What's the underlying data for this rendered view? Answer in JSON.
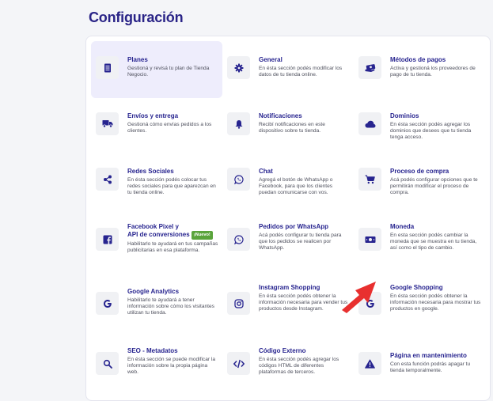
{
  "page": {
    "title": "Configuración"
  },
  "cards": {
    "planes": {
      "title": "Planes",
      "desc": "Gestioná y revisá tu plan de Tienda Negocio.",
      "icon": "document-list-icon"
    },
    "general": {
      "title": "General",
      "desc": "En ésta sección podés modificar los datos de tu tienda online.",
      "icon": "gear-icon"
    },
    "pagos": {
      "title": "Métodos de pagos",
      "desc": "Activa y gestioná los proveedores de pago de tu tienda.",
      "icon": "money-hand-icon"
    },
    "envios": {
      "title": "Envíos y entrega",
      "desc": "Gestioná cómo envías pedidos a los clientes.",
      "icon": "truck-icon"
    },
    "notificaciones": {
      "title": "Notificaciones",
      "desc": "Recibí notificaciones en este dispositivo sobre tu tienda.",
      "icon": "bell-icon"
    },
    "dominios": {
      "title": "Dominios",
      "desc": "En ésta sección podés agregar los dominios que desees que tu tienda tenga acceso.",
      "icon": "cloud-icon"
    },
    "redes": {
      "title": "Redes Sociales",
      "desc": "En ésta sección podés colocar tus redes sociales para que aparezcan en tu tienda online.",
      "icon": "share-icon"
    },
    "chat": {
      "title": "Chat",
      "desc": "Agregá el botón de WhatsApp o Facebook, para que los clientes puedan comunicarse con vos.",
      "icon": "whatsapp-icon"
    },
    "compra": {
      "title": "Proceso de compra",
      "desc": "Acá podés configurar opciones que te permitirán modificar el proceso de compra.",
      "icon": "cart-icon"
    },
    "pixel": {
      "title_line1": "Facebook Pixel y",
      "title_line2": "API de conversiones",
      "badge": "¡Nuevo!",
      "desc": "Habilitarlo te ayudará en tus campañas publicitarias en esa plataforma.",
      "icon": "facebook-icon"
    },
    "pedidos_wa": {
      "title": "Pedidos por WhatsApp",
      "desc": "Acá podés configurar tu tienda para que los pedidos se realicen por WhatsApp.",
      "icon": "whatsapp-icon"
    },
    "moneda": {
      "title": "Moneda",
      "desc": "En esta sección podés cambiar la moneda que se muestra en tu tienda, así como el tipo de cambio.",
      "icon": "banknote-icon"
    },
    "analytics": {
      "title": "Google Analytics",
      "desc": "Habilitarlo te ayudará a tener información sobre cómo los visitantes utilizan tu tienda.",
      "icon": "google-icon"
    },
    "instagram": {
      "title": "Instagram Shopping",
      "desc": "En ésta sección podés obtener la información necesaria para vender tus productos desde Instagram.",
      "icon": "instagram-icon"
    },
    "gshopping": {
      "title": "Google Shopping",
      "desc": "En ésta sección podés obtener la información necesaria para mostrar tus productos en google.",
      "icon": "google-icon"
    },
    "seo": {
      "title": "SEO - Metadatos",
      "desc": "En ésta sección se puede modificar la información sobre la propia página web.",
      "icon": "search-icon"
    },
    "codigo": {
      "title": "Código Externo",
      "desc": "En ésta sección podés agregar los códigos HTML de diferentes plataformas de terceros.",
      "icon": "code-icon"
    },
    "mantenimiento": {
      "title": "Página en mantenimiento",
      "desc": "Con esta función podrás apagar tu tienda temporalmente.",
      "icon": "warning-icon"
    }
  },
  "colors": {
    "accent": "#27248f",
    "selected_bg": "#eeedfc",
    "badge": "#5aa43b",
    "arrow": "#e8302f"
  }
}
